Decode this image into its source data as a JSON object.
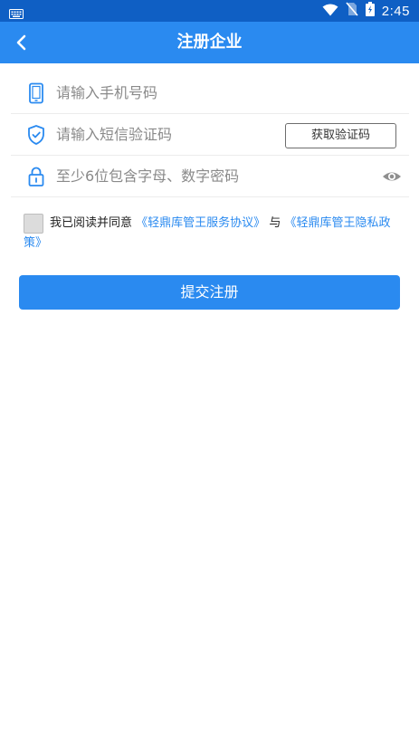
{
  "status_bar": {
    "time": "2:45",
    "icons": [
      "keyboard-icon",
      "wifi-icon",
      "no-sim-icon",
      "battery-charging-icon"
    ]
  },
  "app_bar": {
    "title": "注册企业",
    "back_icon": "chevron-left-icon"
  },
  "form": {
    "phone": {
      "placeholder": "请输入手机号码",
      "icon": "phone-icon"
    },
    "sms_code": {
      "placeholder": "请输入短信验证码",
      "icon": "shield-check-icon",
      "button_label": "获取验证码"
    },
    "password": {
      "placeholder": "至少6位包含字母、数字密码",
      "icon": "lock-icon",
      "toggle_icon": "eye-icon"
    }
  },
  "agreement": {
    "prefix": "我已阅读并同意",
    "service_link": "《轻鼎库管王服务协议》",
    "conjunction": "与",
    "privacy_link": "《轻鼎库管王隐私政策》",
    "checked": false
  },
  "submit_label": "提交注册",
  "colors": {
    "status_bar": "#0f5fc4",
    "primary": "#2a8af0",
    "placeholder": "#8a8a8a",
    "divider": "#ececec"
  }
}
